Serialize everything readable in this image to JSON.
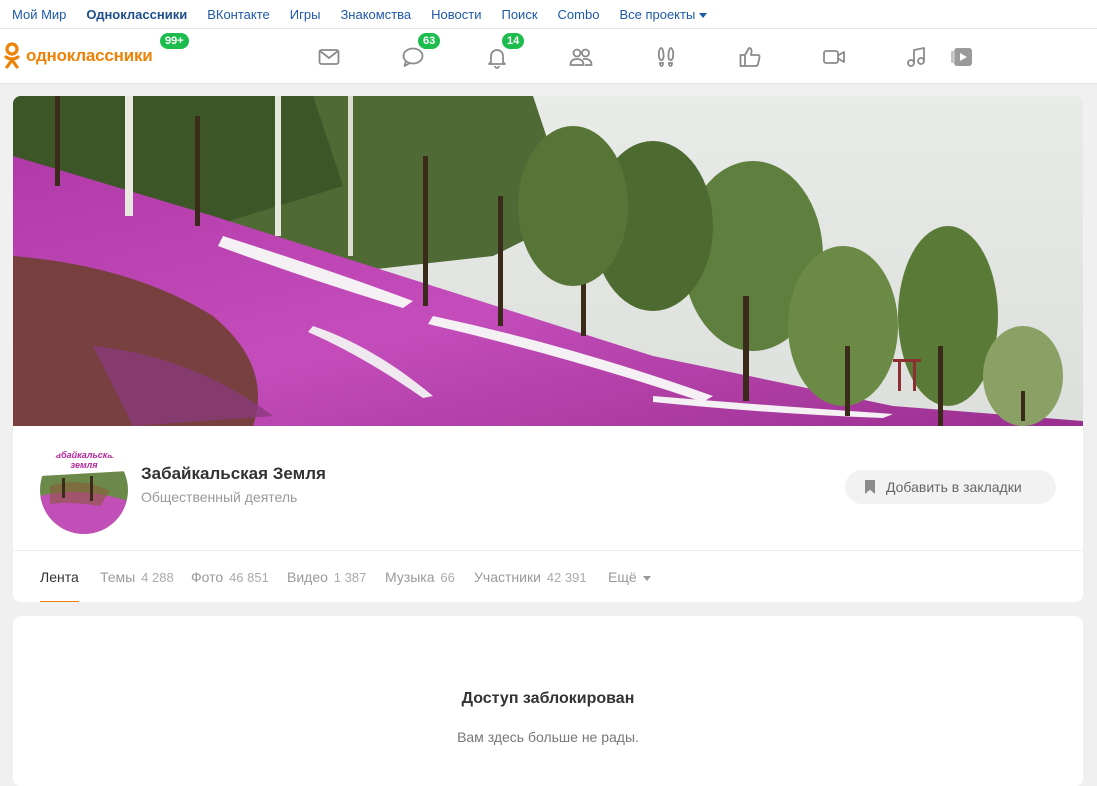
{
  "portal_nav": {
    "items": [
      {
        "label": "Мой Мир",
        "active": false
      },
      {
        "label": "Одноклассники",
        "active": true
      },
      {
        "label": "ВКонтакте",
        "active": false
      },
      {
        "label": "Игры",
        "active": false
      },
      {
        "label": "Знакомства",
        "active": false
      },
      {
        "label": "Новости",
        "active": false
      },
      {
        "label": "Поиск",
        "active": false
      },
      {
        "label": "Combo",
        "active": false
      },
      {
        "label": "Все проекты",
        "active": false
      }
    ]
  },
  "toolbar": {
    "logo_text": "одноклассники",
    "logo_badge": "99+",
    "icons": [
      {
        "name": "messages-icon",
        "badge": ""
      },
      {
        "name": "discussions-icon",
        "badge": "63"
      },
      {
        "name": "notifications-icon",
        "badge": "14"
      },
      {
        "name": "friends-icon",
        "badge": ""
      },
      {
        "name": "guests-icon",
        "badge": ""
      },
      {
        "name": "events-icon",
        "badge": ""
      },
      {
        "name": "video-icon",
        "badge": ""
      },
      {
        "name": "music-icon",
        "badge": ""
      },
      {
        "name": "play-icon",
        "badge": ""
      }
    ],
    "brand_color": "#ee8208",
    "badge_color": "#1cbd4d"
  },
  "group": {
    "name": "Забайкальская Земля",
    "type": "Общественный деятель",
    "avatar_caption": "Забайкальская земля",
    "bookmark_label": "Добавить в закладки"
  },
  "tabs": [
    {
      "label": "Лента",
      "count": "",
      "active": true
    },
    {
      "label": "Темы",
      "count": "4 288",
      "active": false
    },
    {
      "label": "Фото",
      "count": "46 851",
      "active": false
    },
    {
      "label": "Видео",
      "count": "1 387",
      "active": false
    },
    {
      "label": "Музыка",
      "count": "66",
      "active": false
    },
    {
      "label": "Участники",
      "count": "42 391",
      "active": false
    },
    {
      "label": "Ещё",
      "count": "",
      "active": false
    }
  ],
  "blocked": {
    "title": "Доступ заблокирован",
    "message": "Вам здесь больше не рады."
  }
}
